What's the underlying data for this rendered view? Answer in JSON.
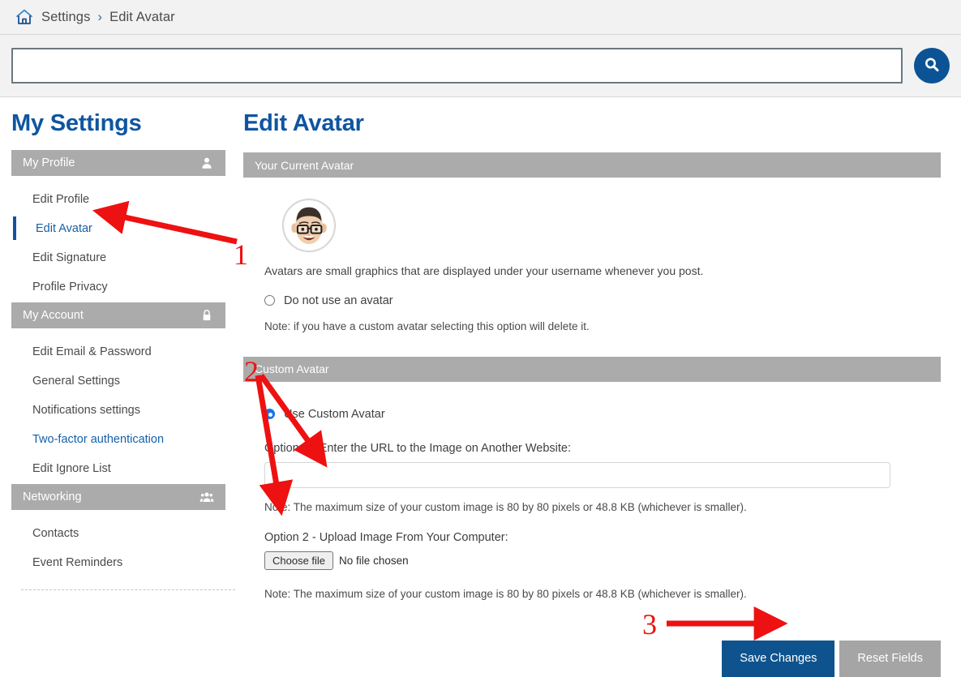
{
  "breadcrumb": {
    "home_icon": "home-icon",
    "items": [
      "Settings",
      "Edit Avatar"
    ],
    "separator": "›"
  },
  "search": {
    "value": "",
    "placeholder": "",
    "button_icon": "search-icon"
  },
  "sidebar": {
    "title": "My Settings",
    "sections": [
      {
        "label": "My Profile",
        "icon": "user-icon",
        "items": [
          {
            "label": "Edit Profile",
            "state": "normal"
          },
          {
            "label": "Edit Avatar",
            "state": "active"
          },
          {
            "label": "Edit Signature",
            "state": "normal"
          },
          {
            "label": "Profile Privacy",
            "state": "normal"
          }
        ]
      },
      {
        "label": "My Account",
        "icon": "lock-icon",
        "items": [
          {
            "label": "Edit Email & Password",
            "state": "normal"
          },
          {
            "label": "General Settings",
            "state": "normal"
          },
          {
            "label": "Notifications settings",
            "state": "normal"
          },
          {
            "label": "Two-factor authentication",
            "state": "link"
          },
          {
            "label": "Edit Ignore List",
            "state": "normal"
          }
        ]
      },
      {
        "label": "Networking",
        "icon": "people-icon",
        "items": [
          {
            "label": "Contacts",
            "state": "normal"
          },
          {
            "label": "Event Reminders",
            "state": "normal"
          }
        ]
      }
    ]
  },
  "main": {
    "title": "Edit Avatar",
    "current_avatar": {
      "panel_header": "Your Current Avatar",
      "avatar_alt": "memoji-avatar",
      "description": "Avatars are small graphics that are displayed under your username whenever you post.",
      "no_avatar_label": "Do not use an avatar",
      "no_avatar_checked": false,
      "no_avatar_note": "Note: if you have a custom avatar selecting this option will delete it."
    },
    "custom_avatar": {
      "panel_header": "Custom Avatar",
      "use_custom_label": "Use Custom Avatar",
      "use_custom_checked": true,
      "option1_label": "Option 1 - Enter the URL to the Image on Another Website:",
      "url_value": "",
      "url_placeholder": "",
      "option1_note": "Note: The maximum size of your custom image is 80 by 80 pixels or 48.8 KB (whichever is smaller).",
      "option2_label": "Option 2 - Upload Image From Your Computer:",
      "file_button_label": "Choose file",
      "file_status": "No file chosen",
      "option2_note": "Note: The maximum size of your custom image is 80 by 80 pixels or 48.8 KB (whichever is smaller)."
    },
    "actions": {
      "save_label": "Save Changes",
      "reset_label": "Reset Fields"
    }
  },
  "annotations": {
    "color": "#ee1111",
    "markers": [
      {
        "label": "1",
        "points_to": "sidebar-item-edit-avatar"
      },
      {
        "label": "2",
        "points_to": "avatar-url-input"
      },
      {
        "label": "3",
        "points_to": "save-changes-button"
      }
    ]
  }
}
